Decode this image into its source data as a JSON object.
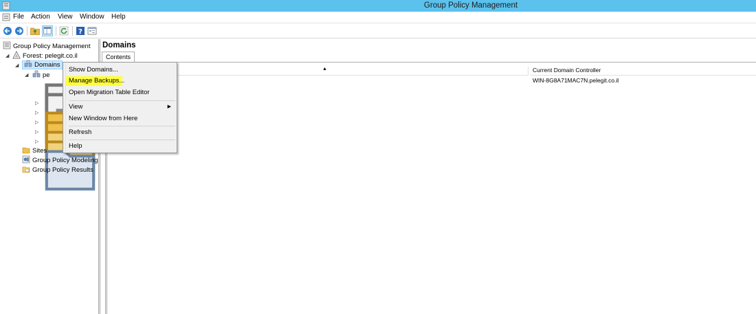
{
  "window": {
    "title": "Group Policy Management"
  },
  "menubar": {
    "items": [
      "File",
      "Action",
      "View",
      "Window",
      "Help"
    ]
  },
  "toolbar": {
    "buttons": [
      "back-icon",
      "forward-icon",
      "up-folder-icon",
      "show-hide-tree-icon",
      "refresh-icon",
      "help-icon",
      "properties-icon"
    ]
  },
  "tree": {
    "root": "Group Policy Management",
    "forest": "Forest: pelegit.co.il",
    "domains": "Domains",
    "domain_partial": "pe",
    "sites": "Sites",
    "modeling": "Group Policy Modeling",
    "results": "Group Policy Results"
  },
  "right_pane": {
    "title": "Domains",
    "tab": "Contents",
    "columns": [
      "",
      "Current Domain Controller"
    ],
    "rows": [
      [
        "",
        "WIN-8G8A71MAC7N.pelegit.co.il"
      ]
    ]
  },
  "context_menu": {
    "items": [
      "Show Domains...",
      "Manage Backups...",
      "Open Migration Table Editor",
      "View",
      "New Window from Here",
      "Refresh",
      "Help"
    ],
    "highlighted": "Manage Backups...",
    "highlight_color": "#ffff3a"
  },
  "colors": {
    "titlebar": "#5bc1ed",
    "selection": "#cce8ff"
  }
}
